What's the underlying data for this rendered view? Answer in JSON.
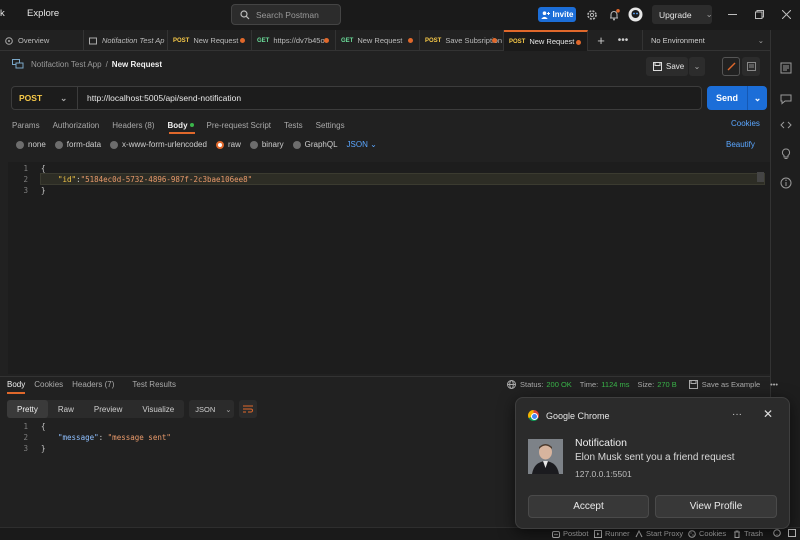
{
  "titlebar": {
    "workspace_fragment": "k",
    "explore": "Explore",
    "search_placeholder": "Search Postman",
    "invite": "Invite",
    "upgrade": "Upgrade"
  },
  "tabs": [
    {
      "method": "",
      "label": "Overview"
    },
    {
      "method": "",
      "label": "Notifaction Test Ap"
    },
    {
      "method": "POST",
      "label": "New Request"
    },
    {
      "method": "GET",
      "label": "https://dv7b45o"
    },
    {
      "method": "GET",
      "label": "New Request"
    },
    {
      "method": "POST",
      "label": "Save Subsription"
    },
    {
      "method": "POST",
      "label": "New Request"
    }
  ],
  "environment": "No Environment",
  "breadcrumb": {
    "collection": "Notifaction Test App",
    "separator": "/",
    "current": "New Request"
  },
  "toolbar": {
    "save": "Save"
  },
  "request": {
    "method": "POST",
    "url": "http://localhost:5005/api/send-notification",
    "send": "Send"
  },
  "request_tabs": {
    "params": "Params",
    "authorization": "Authorization",
    "headers": "Headers (8)",
    "body": "Body",
    "prerequest": "Pre-request Script",
    "tests": "Tests",
    "settings": "Settings",
    "cookies": "Cookies"
  },
  "body_types": {
    "none": "none",
    "form_data": "form-data",
    "urlencoded": "x-www-form-urlencoded",
    "raw": "raw",
    "binary": "binary",
    "graphql": "GraphQL",
    "format": "JSON",
    "beautify": "Beautify"
  },
  "request_body": {
    "line_numbers": [
      "1",
      "2",
      "3"
    ],
    "open": "{",
    "key": "\"id\"",
    "colon": ":",
    "value": "\"5184ec0d-5732-4896-987f-2c3bae106ee8\"",
    "close": "}"
  },
  "response": {
    "tabs": {
      "body": "Body",
      "cookies": "Cookies",
      "headers": "Headers (7)",
      "test_results": "Test Results"
    },
    "status_label": "Status:",
    "status_value": "200 OK",
    "time_label": "Time:",
    "time_value": "1124 ms",
    "size_label": "Size:",
    "size_value": "270 B",
    "save_example": "Save as Example",
    "views": {
      "pretty": "Pretty",
      "raw": "Raw",
      "preview": "Preview",
      "visualize": "Visualize"
    },
    "format": "JSON",
    "line_numbers": [
      "1",
      "2",
      "3"
    ],
    "open": "{",
    "key": "\"message\"",
    "colon": ":",
    "value": "\"message sent\"",
    "close": "}"
  },
  "statusbar": {
    "postbot": "Postbot",
    "runner": "Runner",
    "start_proxy": "Start Proxy",
    "cookies": "Cookies",
    "trash": "Trash"
  },
  "notification": {
    "app": "Google Chrome",
    "title": "Notification",
    "message": "Elon Musk sent you a friend request",
    "source": "127.0.0.1:5501",
    "accept": "Accept",
    "view_profile": "View Profile"
  },
  "colors": {
    "accent": "#e0682b",
    "primary_blue": "#1c6ed8",
    "link_blue": "#5aa6ff",
    "post": "#f7c948",
    "get": "#6bdd9a",
    "ok_green": "#3ab54a"
  }
}
